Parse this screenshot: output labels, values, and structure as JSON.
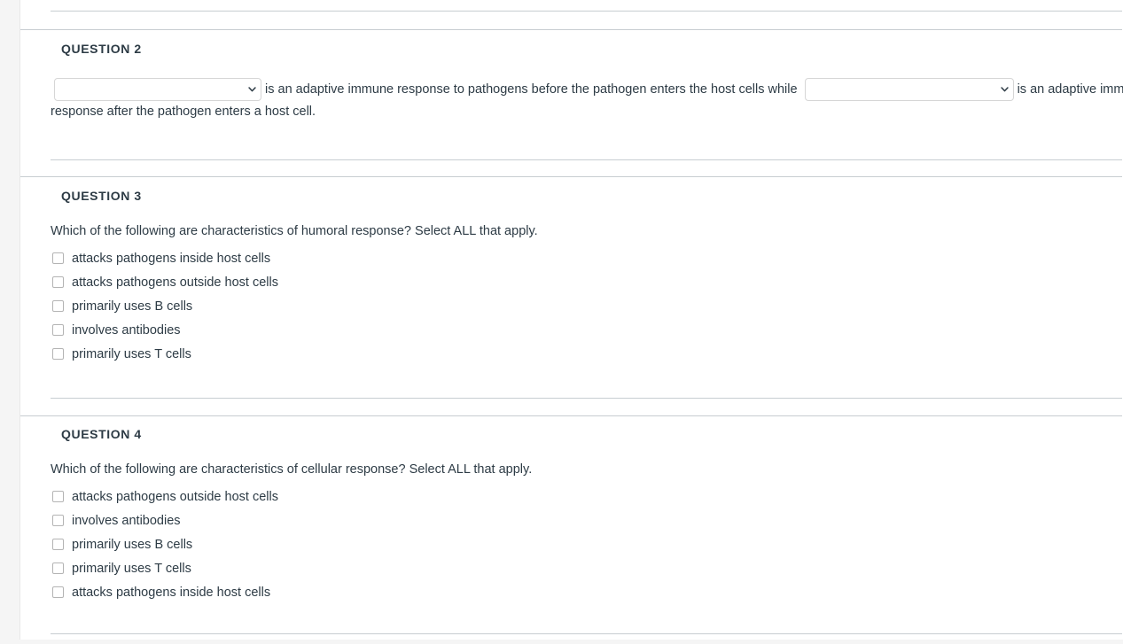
{
  "colors": {
    "page_background": "#f5f5f5",
    "panel_background": "#ffffff",
    "text": "#2d3b45",
    "divider": "#c7cdd1",
    "field_border": "#d6d6d6",
    "checkbox_border": "#b4b4b4"
  },
  "questions": [
    {
      "header": "QUESTION 2",
      "type": "fill-in-multiple-blanks",
      "sentence_parts": {
        "middle": "is an adaptive immune response to pathogens before the pathogen enters the host cells while",
        "tail": "is an adaptive immune response after the pathogen enters a host cell."
      },
      "blanks": [
        {
          "name": "blank-1",
          "value": "",
          "placeholder": ""
        },
        {
          "name": "blank-2",
          "value": "",
          "placeholder": ""
        }
      ]
    },
    {
      "header": "QUESTION 3",
      "type": "multiple-answers",
      "prompt": "Which of the following are characteristics of humoral response? Select ALL that apply.",
      "options": [
        {
          "label": "attacks pathogens inside host cells",
          "checked": false
        },
        {
          "label": "attacks pathogens outside host cells",
          "checked": false
        },
        {
          "label": "primarily uses B cells",
          "checked": false
        },
        {
          "label": "involves antibodies",
          "checked": false
        },
        {
          "label": "primarily uses T cells",
          "checked": false
        }
      ]
    },
    {
      "header": "QUESTION 4",
      "type": "multiple-answers",
      "prompt": "Which of the following are characteristics of cellular response? Select ALL that apply.",
      "options": [
        {
          "label": "attacks pathogens outside host cells",
          "checked": false
        },
        {
          "label": "involves antibodies",
          "checked": false
        },
        {
          "label": "primarily uses B cells",
          "checked": false
        },
        {
          "label": "primarily uses T cells",
          "checked": false
        },
        {
          "label": "attacks pathogens inside host cells",
          "checked": false
        }
      ]
    }
  ]
}
